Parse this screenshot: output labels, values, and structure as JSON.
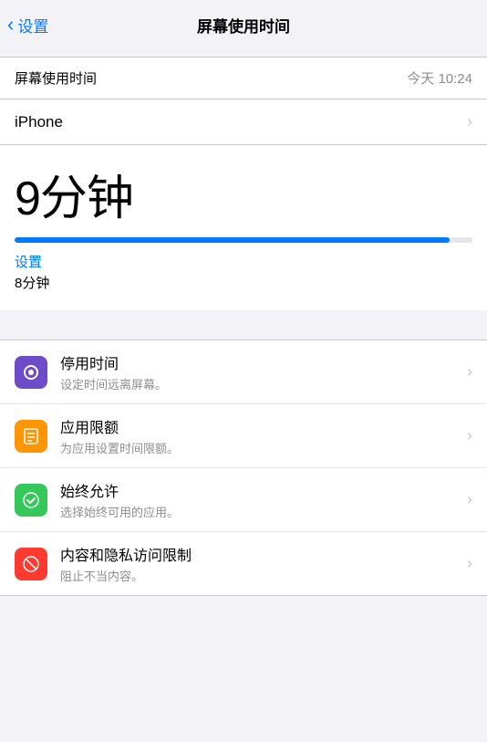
{
  "nav": {
    "back_label": "设置",
    "title": "屏幕使用时间"
  },
  "section_header": {
    "label": "屏幕使用时间",
    "value": "今天 10:24"
  },
  "iphone_row": {
    "label": "iPhone"
  },
  "usage": {
    "time": "9分钟",
    "progress_percent": 95,
    "app_name": "设置",
    "app_time": "8分钟"
  },
  "settings_items": [
    {
      "id": "downtime",
      "icon_color": "purple",
      "icon_symbol": "🌙",
      "title": "停用时间",
      "subtitle": "设定时间远离屏幕。"
    },
    {
      "id": "app_limits",
      "icon_color": "orange",
      "icon_symbol": "⏳",
      "title": "应用限额",
      "subtitle": "为应用设置时间限额。"
    },
    {
      "id": "always_allowed",
      "icon_color": "green",
      "icon_symbol": "✅",
      "title": "始终允许",
      "subtitle": "选择始终可用的应用。"
    },
    {
      "id": "content_privacy",
      "icon_color": "red",
      "icon_symbol": "🚫",
      "title": "内容和隐私访问限制",
      "subtitle": "阻止不当内容。"
    }
  ],
  "colors": {
    "blue": "#007aff",
    "purple": "#6e4bc8",
    "orange": "#ff9500",
    "green": "#34c759",
    "red": "#ff3b30"
  }
}
